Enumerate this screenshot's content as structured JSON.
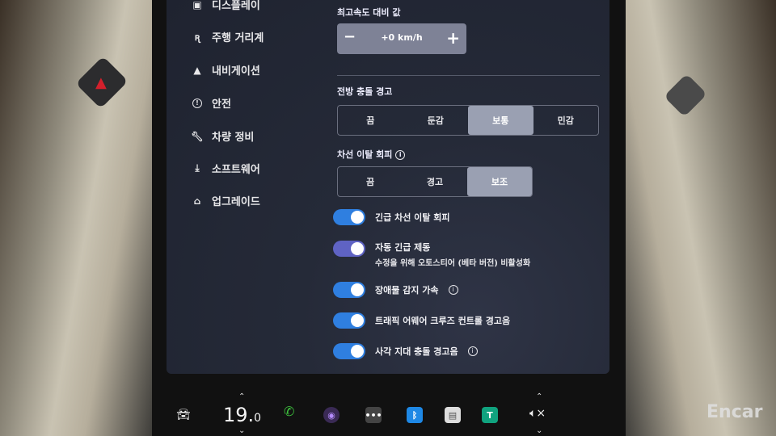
{
  "sidebar": {
    "items": [
      {
        "label": "디스플레이",
        "icon": "display-icon"
      },
      {
        "label": "주행 거리계",
        "icon": "odometer-icon"
      },
      {
        "label": "내비게이션",
        "icon": "navigation-icon"
      },
      {
        "label": "안전",
        "icon": "safety-icon"
      },
      {
        "label": "차량 정비",
        "icon": "wrench-icon"
      },
      {
        "label": "소프트웨어",
        "icon": "download-icon"
      },
      {
        "label": "업그레이드",
        "icon": "lock-icon"
      }
    ]
  },
  "speed_offset": {
    "label": "최고속도 대비 값",
    "value": "+0 km/h",
    "minus": "−",
    "plus": "+"
  },
  "forward_collision": {
    "label": "전방 충돌 경고",
    "options": [
      "끔",
      "둔감",
      "보통",
      "민감"
    ],
    "selected": "보통"
  },
  "lane_departure": {
    "label": "차선 이탈 회피",
    "options": [
      "끔",
      "경고",
      "보조"
    ],
    "selected": "보조"
  },
  "toggles": [
    {
      "label": "긴급 차선 이탈 회피",
      "sub": "",
      "on": true,
      "info": false
    },
    {
      "label": "자동 긴급 제동",
      "sub": "수정을 위해 오토스티어 (베타 버전) 비활성화",
      "on": true,
      "info": false
    },
    {
      "label": "장애물 감지 가속",
      "sub": "",
      "on": true,
      "info": true
    },
    {
      "label": "트래픽 어웨어 크루즈 컨트롤 경고음",
      "sub": "",
      "on": true,
      "info": false
    },
    {
      "label": "사각 지대 충돌 경고음",
      "sub": "",
      "on": true,
      "info": true
    }
  ],
  "dock": {
    "temperature": "19.",
    "temperature_decimal": "0"
  },
  "watermark": "Encar",
  "colors": {
    "accent": "#2f7fe0",
    "selected": "#9aa0b2"
  }
}
